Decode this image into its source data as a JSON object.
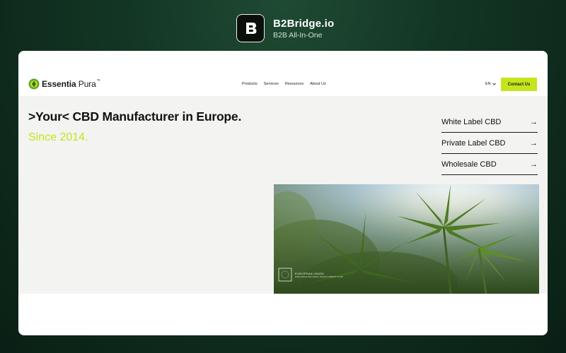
{
  "brand": {
    "name": "B2Bridge.io",
    "tagline": "B2B All-In-One",
    "logo_icon": "b2bridge-logo-icon"
  },
  "site": {
    "logo": {
      "name_bold": "Essentia",
      "name_light": " Pura",
      "trademark": "™",
      "icon": "leaf-logo-icon"
    },
    "nav": {
      "links": [
        "Products",
        "Services",
        "Resources",
        "About Us"
      ],
      "language": "EN",
      "language_icon": "chevron-down-icon",
      "contact_label": "Contact Us"
    },
    "hero": {
      "headline": ">Your< CBD Manufacturer in Europe.",
      "subheadline": "Since 2014.",
      "side_links": [
        {
          "label": "White Label CBD",
          "icon": "arrow-right-icon"
        },
        {
          "label": "Private Label CBD",
          "icon": "arrow-right-icon"
        },
        {
          "label": "Wholesale CBD",
          "icon": "arrow-right-icon"
        }
      ],
      "image": "cannabis-leaves-photo",
      "eu_badge": {
        "line1": "EUROPEAN UNION",
        "line2": "EUROPEAN REGIONAL DEVELOPMENT FUND"
      }
    }
  },
  "colors": {
    "accent": "#c5e51c",
    "subheadline": "#c7e21d",
    "hero_bg": "#f3f3f1",
    "page_bg": "#133624"
  }
}
